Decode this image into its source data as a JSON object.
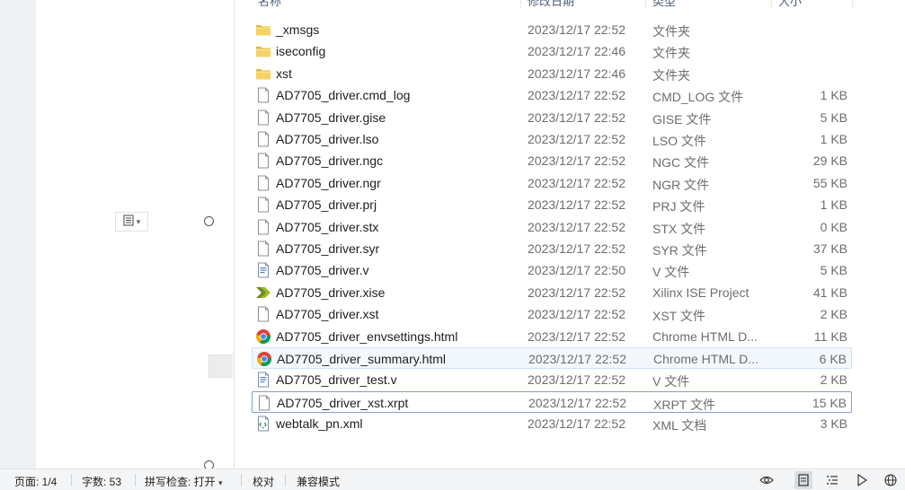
{
  "explorer": {
    "columns": {
      "name": "名称",
      "date": "修改日期",
      "type": "类型",
      "size": "大小"
    },
    "files": [
      {
        "icon": "folder-icon",
        "name": "_xmsgs",
        "date": "2023/12/17 22:52",
        "type": "文件夹",
        "size": ""
      },
      {
        "icon": "folder-icon",
        "name": "iseconfig",
        "date": "2023/12/17 22:46",
        "type": "文件夹",
        "size": ""
      },
      {
        "icon": "folder-icon",
        "name": "xst",
        "date": "2023/12/17 22:46",
        "type": "文件夹",
        "size": ""
      },
      {
        "icon": "file-icon",
        "name": "AD7705_driver.cmd_log",
        "date": "2023/12/17 22:52",
        "type": "CMD_LOG 文件",
        "size": "1 KB"
      },
      {
        "icon": "file-icon",
        "name": "AD7705_driver.gise",
        "date": "2023/12/17 22:52",
        "type": "GISE 文件",
        "size": "5 KB"
      },
      {
        "icon": "file-icon",
        "name": "AD7705_driver.lso",
        "date": "2023/12/17 22:52",
        "type": "LSO 文件",
        "size": "1 KB"
      },
      {
        "icon": "file-icon",
        "name": "AD7705_driver.ngc",
        "date": "2023/12/17 22:52",
        "type": "NGC 文件",
        "size": "29 KB"
      },
      {
        "icon": "file-icon",
        "name": "AD7705_driver.ngr",
        "date": "2023/12/17 22:52",
        "type": "NGR 文件",
        "size": "55 KB"
      },
      {
        "icon": "file-icon",
        "name": "AD7705_driver.prj",
        "date": "2023/12/17 22:52",
        "type": "PRJ 文件",
        "size": "1 KB"
      },
      {
        "icon": "file-icon",
        "name": "AD7705_driver.stx",
        "date": "2023/12/17 22:52",
        "type": "STX 文件",
        "size": "0 KB"
      },
      {
        "icon": "file-icon",
        "name": "AD7705_driver.syr",
        "date": "2023/12/17 22:52",
        "type": "SYR 文件",
        "size": "37 KB"
      },
      {
        "icon": "verilog-file-icon",
        "name": "AD7705_driver.v",
        "date": "2023/12/17 22:50",
        "type": "V 文件",
        "size": "5 KB"
      },
      {
        "icon": "xilinx-ise-icon",
        "name": "AD7705_driver.xise",
        "date": "2023/12/17 22:52",
        "type": "Xilinx ISE Project",
        "size": "41 KB"
      },
      {
        "icon": "file-icon",
        "name": "AD7705_driver.xst",
        "date": "2023/12/17 22:52",
        "type": "XST 文件",
        "size": "2 KB"
      },
      {
        "icon": "chrome-icon",
        "name": "AD7705_driver_envsettings.html",
        "date": "2023/12/17 22:52",
        "type": "Chrome HTML D...",
        "size": "11 KB"
      },
      {
        "icon": "chrome-icon",
        "name": "AD7705_driver_summary.html",
        "date": "2023/12/17 22:52",
        "type": "Chrome HTML D...",
        "size": "6 KB"
      },
      {
        "icon": "verilog-file-icon",
        "name": "AD7705_driver_test.v",
        "date": "2023/12/17 22:52",
        "type": "V 文件",
        "size": "2 KB"
      },
      {
        "icon": "file-icon",
        "name": "AD7705_driver_xst.xrpt",
        "date": "2023/12/17 22:52",
        "type": "XRPT 文件",
        "size": "15 KB"
      },
      {
        "icon": "xml-file-icon",
        "name": "webtalk_pn.xml",
        "date": "2023/12/17 22:52",
        "type": "XML 文档",
        "size": "3 KB"
      }
    ]
  },
  "statusbar": {
    "page": "页面: 1/4",
    "words": "字数: 53",
    "spellcheck": "拼写检查: 打开",
    "proofread": "校对",
    "compat": "兼容模式"
  },
  "icons": {
    "anchor": "paragraph-anchor-icon",
    "eye": "eye-icon",
    "page_view": "page-view-icon",
    "outline_view": "outline-view-icon",
    "play": "play-icon",
    "web": "globe-icon"
  },
  "colors": {
    "hover_bg": "#f3f8fd",
    "focus_border": "#7da2ce",
    "folder": "#f0c44c"
  }
}
